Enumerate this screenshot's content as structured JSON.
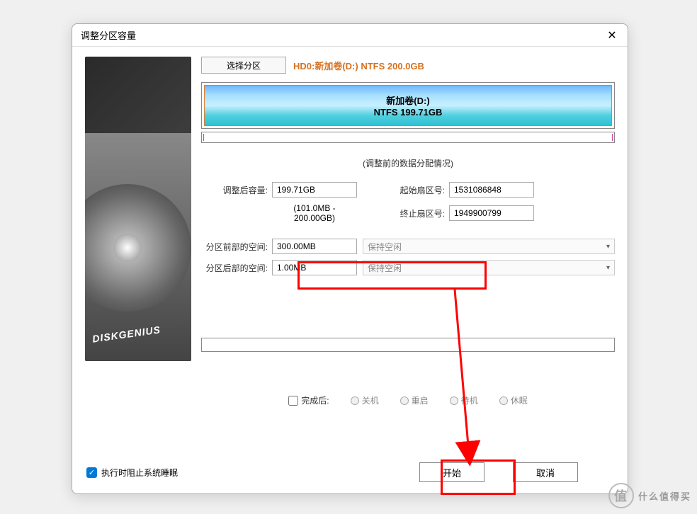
{
  "dialog": {
    "title": "调整分区容量",
    "close": "✕"
  },
  "select_partition_btn": "选择分区",
  "selected_disk": "HD0:新加卷(D:) NTFS 200.0GB",
  "partition": {
    "name": "新加卷(D:)",
    "size": "NTFS 199.71GB"
  },
  "before_label": "(调整前的数据分配情况)",
  "fields": {
    "after_size_label": "调整后容量:",
    "after_size_value": "199.71GB",
    "range_hint": "(101.0MB - 200.00GB)",
    "start_sector_label": "起始扇区号:",
    "start_sector_value": "1531086848",
    "end_sector_label": "终止扇区号:",
    "end_sector_value": "1949900799",
    "space_before_label": "分区前部的空间:",
    "space_before_value": "300.00MB",
    "space_after_label": "分区后部的空间:",
    "space_after_value": "1.00MB",
    "keep_free": "保持空闲"
  },
  "after_action": {
    "label": "完成后:",
    "shutdown": "关机",
    "restart": "重启",
    "standby": "待机",
    "hibernate": "休眠"
  },
  "prevent_sleep": "执行时阻止系统睡眠",
  "buttons": {
    "start": "开始",
    "cancel": "取消"
  },
  "sidebar_brand": "DISKGENIUS",
  "watermark": {
    "icon": "值",
    "text": "什么值得买"
  }
}
